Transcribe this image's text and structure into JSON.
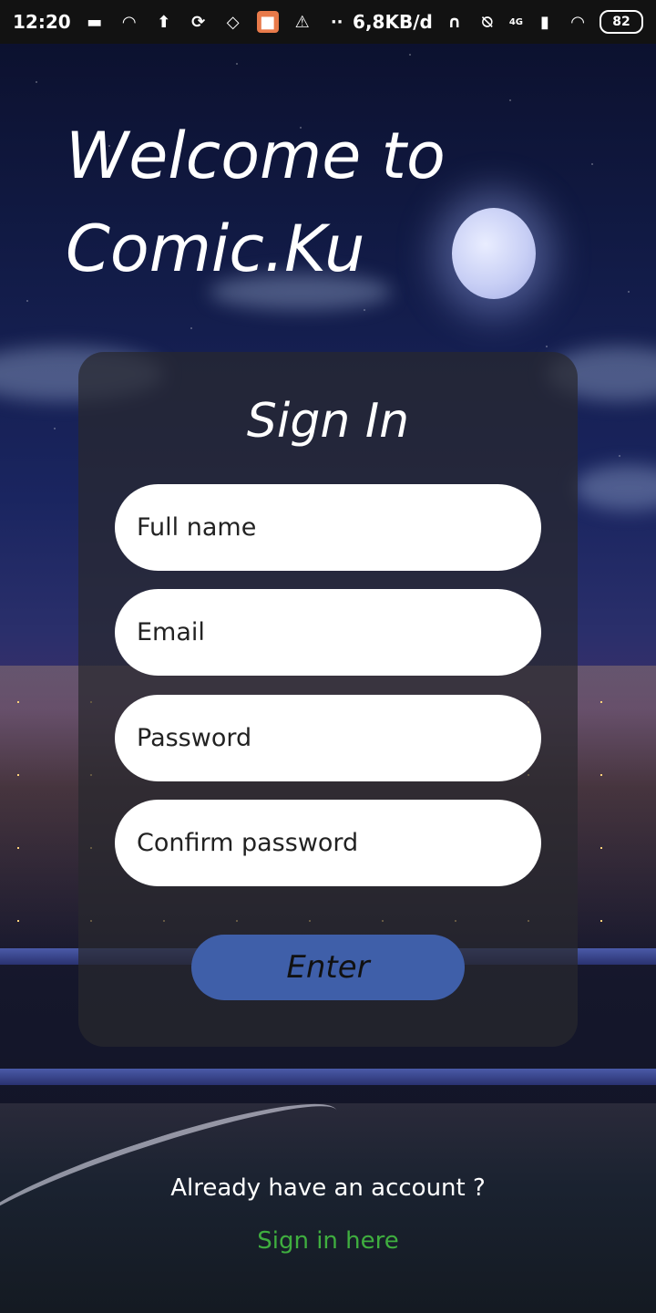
{
  "status_bar": {
    "time": "12:20",
    "network_speed": "6,8KB/d",
    "signal_label": "4G",
    "battery": "82",
    "icons": [
      "chat-icon",
      "wifi-icon",
      "upload-icon",
      "sync-icon",
      "vpn-icon",
      "app-icon",
      "warning-icon",
      "dots-icon",
      "headphones-icon",
      "mute-bell-icon",
      "signal-icon",
      "wifi-icon",
      "battery-icon"
    ]
  },
  "welcome": {
    "line1": "Welcome to",
    "line2": "Comic.Ku"
  },
  "form": {
    "title": "Sign In",
    "full_name_placeholder": "Full name",
    "email_placeholder": "Email",
    "password_placeholder": "Password",
    "confirm_password_placeholder": "Confirm password",
    "enter_label": "Enter"
  },
  "footer": {
    "already_text": "Already have an account ?",
    "signin_link": "Sign in here"
  },
  "colors": {
    "button": "#3f5fa9",
    "link": "#3fae3f",
    "card": "rgba(40,40,46,0.72)"
  }
}
